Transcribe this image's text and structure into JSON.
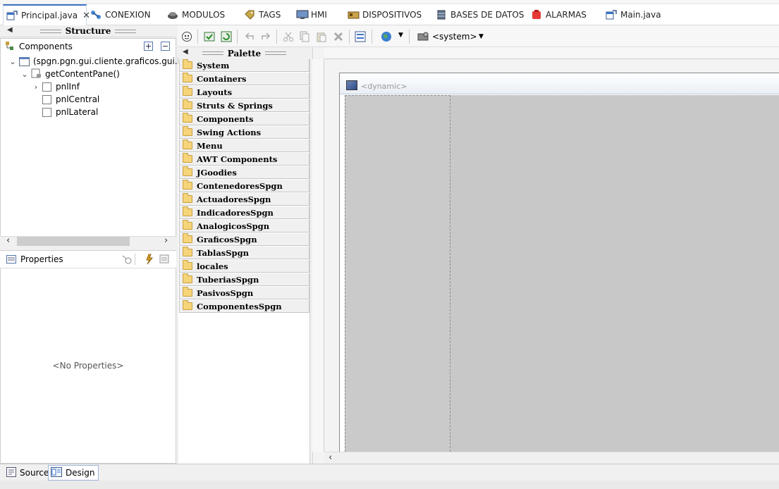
{
  "tabs": [
    {
      "label": "Principal.java",
      "icon": "java-frame-icon",
      "active": true,
      "closable": true
    },
    {
      "label": "CONEXION",
      "icon": "network-icon"
    },
    {
      "label": "MODULOS",
      "icon": "modules-icon"
    },
    {
      "label": "TAGS",
      "icon": "tag-icon"
    },
    {
      "label": "HMI",
      "icon": "monitor-icon"
    },
    {
      "label": "DISPOSITIVOS",
      "icon": "devices-icon"
    },
    {
      "label": "BASES DE DATOS",
      "icon": "database-icon"
    },
    {
      "label": "ALARMAS",
      "icon": "alarm-icon"
    },
    {
      "label": "Main.java",
      "icon": "java-frame-icon"
    }
  ],
  "tab_close_glyph": "✕",
  "structure": {
    "title": "Structure",
    "components_title": "Components",
    "tree": [
      {
        "label": "(spgn.pgn.gui.cliente.graficos.gui.Frai",
        "level": 0,
        "expanded": true
      },
      {
        "label": "getContentPane()",
        "level": 1,
        "expanded": true
      },
      {
        "label": "pnlInf",
        "level": 2,
        "expanded": false
      },
      {
        "label": "pnlCentral",
        "level": 2
      },
      {
        "label": "pnlLateral",
        "level": 2
      }
    ]
  },
  "properties": {
    "title": "Properties",
    "empty_text": "<No Properties>"
  },
  "toolbar": {
    "system_label": "<system>"
  },
  "palette": {
    "title": "Palette",
    "items": [
      "System",
      "Containers",
      "Layouts",
      "Struts & Springs",
      "Components",
      "Swing Actions",
      "Menu",
      "AWT Components",
      "JGoodies",
      "ContenedoresSpgn",
      "ActuadoresSpgn",
      "IndicadoresSpgn",
      "AnalogicosSpgn",
      "GraficosSpgn",
      "TablasSpgn",
      "locales",
      "TuberiasSpgn",
      "PasivosSpgn",
      "ComponentesSpgn"
    ]
  },
  "canvas": {
    "frame_title": "<dynamic>"
  },
  "bottom_tabs": [
    {
      "label": "Source",
      "active": false
    },
    {
      "label": "Design",
      "active": true
    }
  ],
  "colors": {
    "accent": "#3b73c4",
    "folder": "#f5d47a",
    "design_bg": "#c8c8c8",
    "alarm": "#e53935"
  }
}
